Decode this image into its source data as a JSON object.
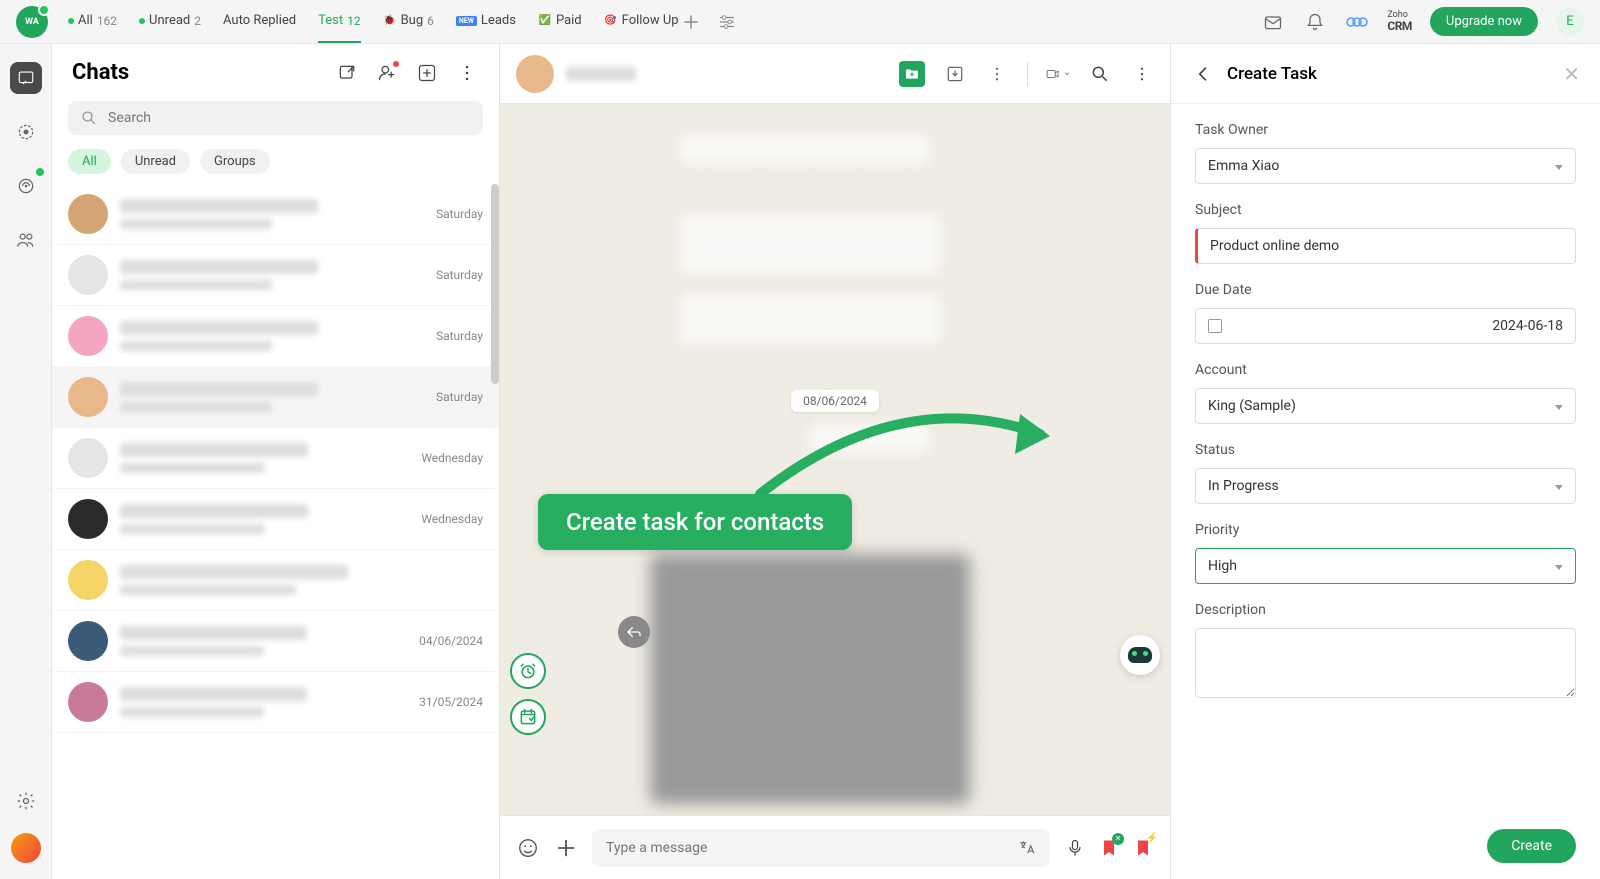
{
  "top": {
    "logo_text": "WA",
    "tabs": [
      {
        "label": "All",
        "count": "162",
        "dot": true
      },
      {
        "label": "Unread",
        "count": "2",
        "dot": true
      },
      {
        "label": "Auto Replied",
        "count": ""
      },
      {
        "label": "Test",
        "count": "12",
        "active": true
      },
      {
        "label": "Bug",
        "count": "6",
        "icon": "🐞"
      },
      {
        "label": "Leads",
        "count": "",
        "icon_bg": "#3b82f6",
        "icon_txt": "NEW"
      },
      {
        "label": "Paid",
        "count": "",
        "icon": "✅"
      },
      {
        "label": "Follow Up",
        "count": "",
        "icon": "🎯"
      }
    ],
    "upgrade": "Upgrade now",
    "zoho_small": "Zoho",
    "zoho_big": "CRM",
    "avatar_letter": "E"
  },
  "chatlist": {
    "title": "Chats",
    "search_placeholder": "Search",
    "filters": [
      {
        "label": "All",
        "active": true
      },
      {
        "label": "Unread"
      },
      {
        "label": "Groups"
      }
    ],
    "items": [
      {
        "time": "Saturday",
        "color": "#d4a574"
      },
      {
        "time": "Saturday",
        "color": "#e5e5e5"
      },
      {
        "time": "Saturday",
        "color": "#f4a6c1"
      },
      {
        "time": "Saturday",
        "color": "#e8b88a",
        "selected": true
      },
      {
        "time": "Wednesday",
        "color": "#e5e5e5"
      },
      {
        "time": "Wednesday",
        "color": "#2a2a2a"
      },
      {
        "time": "",
        "color": "#f5d565"
      },
      {
        "time": "04/06/2024",
        "color": "#3a5a7a"
      },
      {
        "time": "31/05/2024",
        "color": "#c77a9a"
      }
    ]
  },
  "conv": {
    "date_chip": "08/06/2024",
    "composer_placeholder": "Type a message",
    "overlay_text": "Create task for contacts"
  },
  "panel": {
    "title": "Create Task",
    "fields": {
      "owner_label": "Task Owner",
      "owner_value": "Emma Xiao",
      "subject_label": "Subject",
      "subject_value": "Product online demo",
      "due_label": "Due Date",
      "due_value": "2024-06-18",
      "account_label": "Account",
      "account_value": "King (Sample)",
      "status_label": "Status",
      "status_value": "In Progress",
      "priority_label": "Priority",
      "priority_value": "High",
      "desc_label": "Description"
    },
    "create_btn": "Create"
  }
}
